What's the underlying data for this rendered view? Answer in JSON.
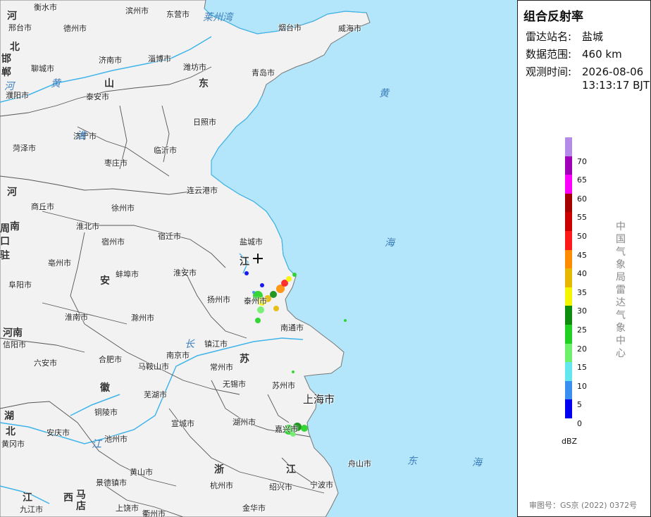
{
  "panel": {
    "title": "组合反射率",
    "station_label": "雷达站名:",
    "station_value": "盐城",
    "range_label": "数据范围:",
    "range_value": "460 km",
    "time_label": "观测时间:",
    "time_date": "2026-08-06",
    "time_clock": "13:13:17 BJT",
    "unit": "dBZ",
    "agency": "中国气象局雷达气象中心",
    "approval": "审图号：GS京 (2022) 0372号"
  },
  "legend": {
    "colors": [
      "#0000f0",
      "#3a8ff0",
      "#64e6ee",
      "#6ef06a",
      "#21d121",
      "#0d8c0d",
      "#f5f500",
      "#e6b800",
      "#ff8c00",
      "#ff1a1a",
      "#cc0000",
      "#a50000",
      "#ff00ff",
      "#a000b8",
      "#b48ce8"
    ],
    "ticks": [
      "0",
      "5",
      "10",
      "15",
      "20",
      "25",
      "30",
      "35",
      "40",
      "45",
      "50",
      "55",
      "60",
      "65",
      "70"
    ]
  },
  "map": {
    "colors": {
      "sea": "#b3e6fa",
      "land": "#f2f2f2",
      "border": "#555555",
      "water": "#3fb4ea"
    },
    "cities": [
      "衡水市",
      "滨州市",
      "东营市",
      "邢台市",
      "德州市",
      "烟台市",
      "威海市",
      "济南市",
      "淄博市",
      "潍坊市",
      "聊城市",
      "青岛市",
      "泰安市",
      "日照市",
      "濮阳市",
      "济宁市",
      "菏泽市",
      "临沂市",
      "枣庄市",
      "连云港市",
      "商丘市",
      "徐州市",
      "淮北市",
      "宿州市",
      "宿迁市",
      "盐城市",
      "亳州市",
      "蚌埠市",
      "淮安市",
      "阜阳市",
      "扬州市",
      "泰州市",
      "淮南市",
      "滁州市",
      "南通市",
      "信阳市",
      "镇江市",
      "六安市",
      "合肥市",
      "南京市",
      "马鞍山市",
      "常州市",
      "无锡市",
      "苏州市",
      "芜湖市",
      "铜陵市",
      "上海市",
      "安庆市",
      "宣城市",
      "湖州市",
      "嘉兴市",
      "池州市",
      "黄冈市",
      "黄山市",
      "杭州市",
      "绍兴市",
      "宁波市",
      "舟山市",
      "九江市",
      "景德镇市",
      "上饶市",
      "衢州市",
      "金华市"
    ],
    "provinces": [
      "河",
      "北",
      "山",
      "东",
      "河",
      "南",
      "安",
      "徽",
      "江",
      "苏",
      "浙",
      "江",
      "湖",
      "北",
      "江",
      "西",
      "邯",
      "郸",
      "周",
      "口",
      "驻",
      "马",
      "店",
      "河南"
    ],
    "seas": [
      "莱州湾",
      "黄",
      "海",
      "东",
      "海",
      "长",
      "江",
      "黄",
      "河",
      "淮"
    ]
  }
}
